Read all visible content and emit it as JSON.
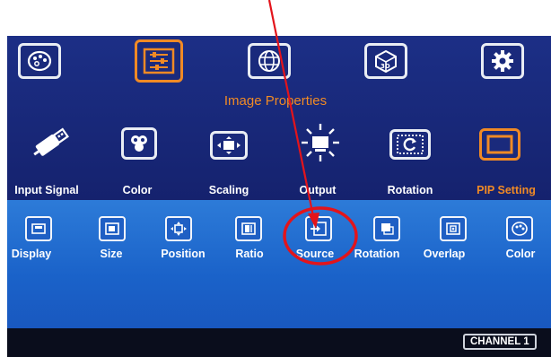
{
  "menu": {
    "section_title": "Image Properties",
    "top_icons": [
      {
        "name": "palette",
        "active": false
      },
      {
        "name": "image-properties",
        "active": true
      },
      {
        "name": "globe",
        "active": false
      },
      {
        "name": "3d",
        "active": false
      },
      {
        "name": "settings",
        "active": false
      }
    ],
    "categories": [
      {
        "label": "Input Signal",
        "selected": false
      },
      {
        "label": "Color",
        "selected": false
      },
      {
        "label": "Scaling",
        "selected": false
      },
      {
        "label": "Output",
        "selected": false
      },
      {
        "label": "Rotation",
        "selected": false
      },
      {
        "label": "PIP Setting",
        "selected": true
      }
    ],
    "sub_items": [
      {
        "label": "Display"
      },
      {
        "label": "Size"
      },
      {
        "label": "Position"
      },
      {
        "label": "Ratio"
      },
      {
        "label": "Source",
        "highlighted": true
      },
      {
        "label": "Rotation"
      },
      {
        "label": "Overlap"
      },
      {
        "label": "Color"
      }
    ]
  },
  "status": {
    "channel": "CHANNEL 1"
  },
  "colors": {
    "accent": "#f08a25",
    "annotation_red": "#e3141b",
    "top_panel": "#1c2f86",
    "sub_panel": "#1f6ad0"
  }
}
